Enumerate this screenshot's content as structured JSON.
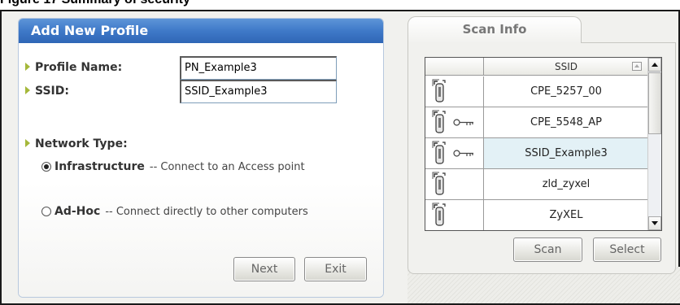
{
  "caption": "Figure 17   Summary of security",
  "profile": {
    "title": "Add New Profile",
    "profile_name_label": "Profile Name:",
    "profile_name_value": "PN_Example3",
    "ssid_label": "SSID:",
    "ssid_value": "SSID_Example3",
    "network_type_label": "Network Type:",
    "options": [
      {
        "title": "Infrastructure",
        "desc": "-- Connect to an Access point",
        "checked": true
      },
      {
        "title": "Ad-Hoc",
        "desc": "-- Connect directly to other computers",
        "checked": false
      }
    ],
    "next_label": "Next",
    "exit_label": "Exit"
  },
  "scan": {
    "tab_label": "Scan Info",
    "column_header": "SSID",
    "rows": [
      {
        "ssid": "CPE_5257_00",
        "secured": false,
        "selected": false
      },
      {
        "ssid": "CPE_5548_AP",
        "secured": true,
        "selected": false
      },
      {
        "ssid": "SSID_Example3",
        "secured": true,
        "selected": true
      },
      {
        "ssid": "zld_zyxel",
        "secured": false,
        "selected": false
      },
      {
        "ssid": "ZyXEL",
        "secured": false,
        "selected": false
      }
    ],
    "scan_label": "Scan",
    "select_label": "Select"
  },
  "icons": {
    "access_point": "access-point-icon",
    "key": "key-icon",
    "sort": "sort-icon",
    "scroll_up": "scroll-up-icon",
    "scroll_down": "scroll-down-icon"
  },
  "colors": {
    "header_blue": "#3f79c8",
    "bullet_green": "#a5b83a",
    "selected_row": "#e3f1f6"
  }
}
